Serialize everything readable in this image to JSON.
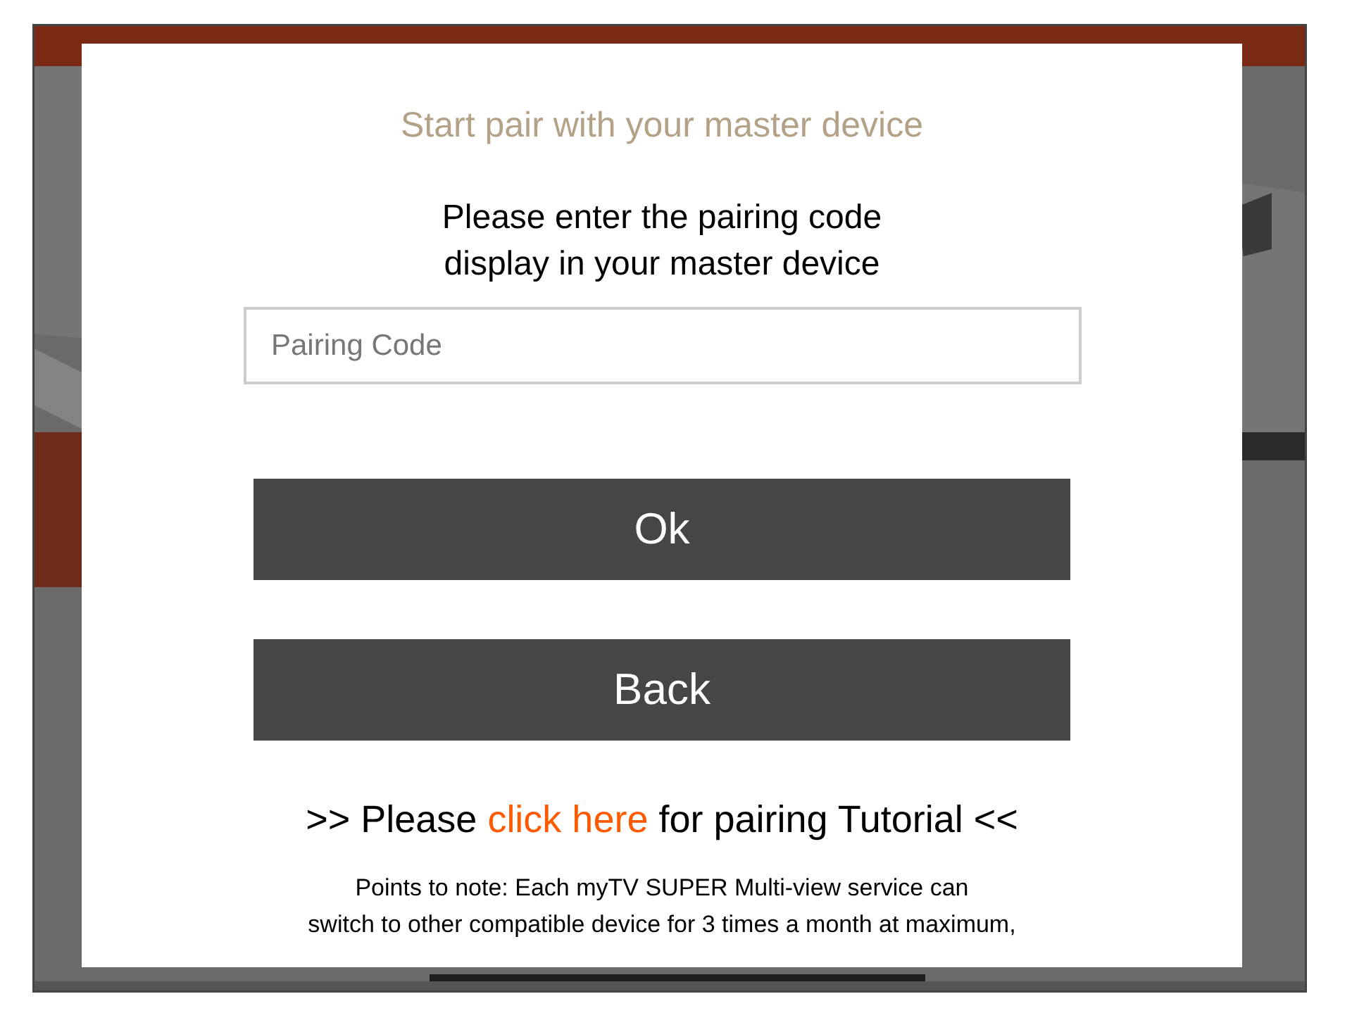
{
  "dialog": {
    "title": "Start pair with your master device",
    "instruction_lines": [
      "Please enter the pairing code",
      "display in your master device"
    ],
    "pairing_code": {
      "placeholder": "Pairing Code"
    },
    "buttons": [
      "Ok",
      "Back"
    ],
    "tutorial": {
      "before": ">> Please",
      "link": "click here",
      "after": "for pairing Tutorial <<"
    },
    "note_lines": [
      "Points to note: Each myTV SUPER Multi-view service can",
      "switch to other compatible device for 3 times a month at maximum,"
    ]
  }
}
